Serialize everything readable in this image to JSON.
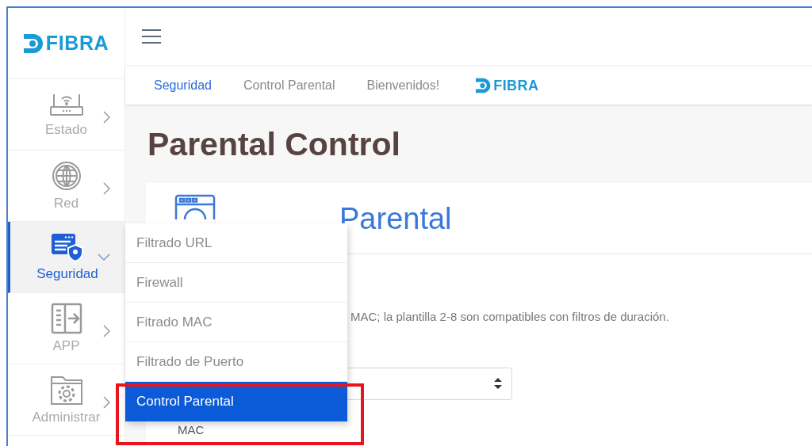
{
  "sidebar": {
    "logo": {
      "text": "FIBRA"
    },
    "items": [
      {
        "kind": "router",
        "label": "Estado",
        "selected": false,
        "expanded": false
      },
      {
        "kind": "globe",
        "label": "Red",
        "selected": false,
        "expanded": false
      },
      {
        "kind": "shield",
        "label": "Seguridad",
        "selected": true,
        "expanded": true
      },
      {
        "kind": "app",
        "label": "APP",
        "selected": false,
        "expanded": false
      },
      {
        "kind": "folder",
        "label": "Administrar",
        "selected": false,
        "expanded": false
      }
    ]
  },
  "breadcrumb": {
    "items": [
      {
        "label": "Seguridad",
        "selected": true
      },
      {
        "label": "Control Parental",
        "selected": false
      },
      {
        "label": "Bienvenidos!",
        "selected": false
      }
    ],
    "logo": {
      "text": "FIBRA"
    }
  },
  "page_title": "Parental Control",
  "card": {
    "title": "Parental",
    "note": "MAC; la plantilla 2-8 son compatibles con filtros de duración.",
    "field_label": "MAC"
  },
  "submenu": [
    {
      "label": "Filtrado URL",
      "selected": false
    },
    {
      "label": "Firewall",
      "selected": false
    },
    {
      "label": "Fitrado MAC",
      "selected": false
    },
    {
      "label": "Filtrado de Puerto",
      "selected": false
    },
    {
      "label": "Control Parental",
      "selected": true
    }
  ]
}
